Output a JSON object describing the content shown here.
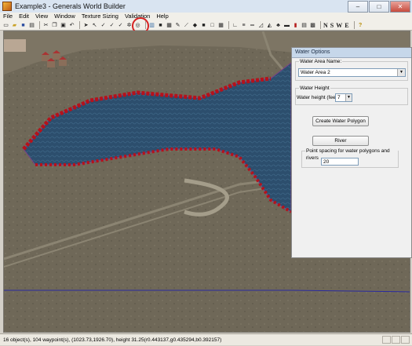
{
  "window": {
    "title": "Example3 - Generals World Builder",
    "controls": {
      "minimize": "–",
      "maximize": "□",
      "close": "✕"
    }
  },
  "menu": [
    {
      "label": "File",
      "name": "menu-file"
    },
    {
      "label": "Edit",
      "name": "menu-edit"
    },
    {
      "label": "View",
      "name": "menu-view"
    },
    {
      "label": "Window",
      "name": "menu-window"
    },
    {
      "label": "Texture Sizing",
      "name": "menu-texture-sizing"
    },
    {
      "label": "Validation",
      "name": "menu-validation"
    },
    {
      "label": "Help",
      "name": "menu-help"
    }
  ],
  "toolbar": {
    "icons": [
      "new-file-icon",
      "open-folder-icon",
      "save-icon",
      "print-icon",
      "cut-icon",
      "copy-icon",
      "paste-icon",
      "undo-icon",
      "pointer-icon",
      "select-icon",
      "checkmark-icon",
      "checkmark-icon",
      "checkmark-icon",
      "gear-icon",
      "target-icon",
      "water-tool-icon",
      "black-square-icon",
      "checkered-icon",
      "pen-icon",
      "brush-icon",
      "fill-icon",
      "black-block-icon",
      "square-icon",
      "grid-icon",
      "line-icon",
      "ramp-icon",
      "road-icon",
      "triangle-icon",
      "object-icon",
      "build-icon",
      "waypoint-icon",
      "paint-icon",
      "map-icon",
      "scorch-icon"
    ],
    "compass": [
      "N",
      "S",
      "W",
      "E"
    ],
    "help_glyph": "?"
  },
  "water_options": {
    "title": "Water Options",
    "area_name_label": "Water Area Name:",
    "area_name_value": "Water Area 2",
    "height_group_label": "Water Height",
    "height_label": "Water height (feet):",
    "height_value": "7",
    "create_button": "Create Water Polygon",
    "river_button": "River",
    "spacing_label": "Point spacing for water polygons and rivers",
    "spacing_value": "20"
  },
  "status": {
    "text": "16 object(s), 104 waypoint(s), (1023.73,1926.70), height 31.25(r0.443137,g0.435294,b0.392157)"
  },
  "colors": {
    "terrain": "#6e6757",
    "water": "#2c4e6d",
    "shore_rocks": "#b5121b",
    "highlight": "#d62222"
  }
}
